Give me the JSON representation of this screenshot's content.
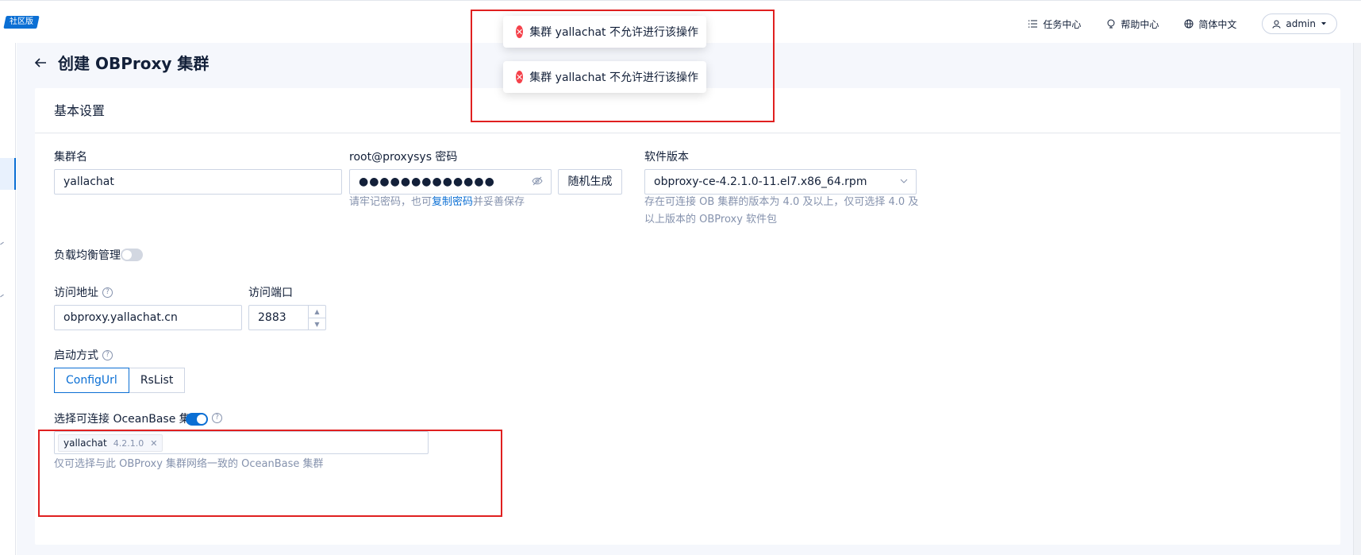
{
  "topbar": {
    "edition_badge": "社区版",
    "nav": {
      "tasks": "任务中心",
      "help": "帮助中心",
      "language": "简体中文",
      "user": "admin"
    },
    "icons": [
      "list-icon",
      "bulb-icon",
      "globe-icon",
      "user-icon",
      "caret-down-icon"
    ]
  },
  "page": {
    "title": "创建 OBProxy 集群"
  },
  "toasts": [
    {
      "text": "集群 yallachat 不允许进行该操作"
    },
    {
      "text": "集群 yallachat 不允许进行该操作"
    }
  ],
  "form": {
    "section_title": "基本设置",
    "cluster_name": {
      "label": "集群名",
      "value": "yallachat"
    },
    "password": {
      "label": "root@proxysys 密码",
      "value": "●●●●●●●●●●●●●",
      "generate_button": "随机生成",
      "hint_prefix": "请牢记密码，也可",
      "hint_link": "复制密码",
      "hint_suffix": "并妥善保存"
    },
    "version": {
      "label": "软件版本",
      "value": "obproxy-ce-4.2.1.0-11.el7.x86_64.rpm",
      "hint_line1": "存在可连接 OB 集群的版本为 4.0 及以上，仅可选择 4.0 及",
      "hint_line2": "以上版本的 OBProxy 软件包"
    },
    "load_balance": {
      "label": "负载均衡管理",
      "enabled": false
    },
    "address": {
      "label": "访问地址",
      "value": "obproxy.yallachat.cn"
    },
    "port": {
      "label": "访问端口",
      "value": "2883"
    },
    "start_mode": {
      "label": "启动方式",
      "options": [
        "ConfigUrl",
        "RsList"
      ],
      "selected": "ConfigUrl"
    },
    "connect_cluster": {
      "label": "选择可连接 OceanBase 集群",
      "enabled": true,
      "tag_name": "yallachat",
      "tag_version": "4.2.1.0",
      "hint": "仅可选择与此 OBProxy 集群网络一致的 OceanBase 集群"
    }
  },
  "colors": {
    "primary": "#0b6fd4",
    "error": "#f5424b",
    "highlight_box": "#e02020",
    "text": "#132039",
    "muted": "#8592ad"
  }
}
